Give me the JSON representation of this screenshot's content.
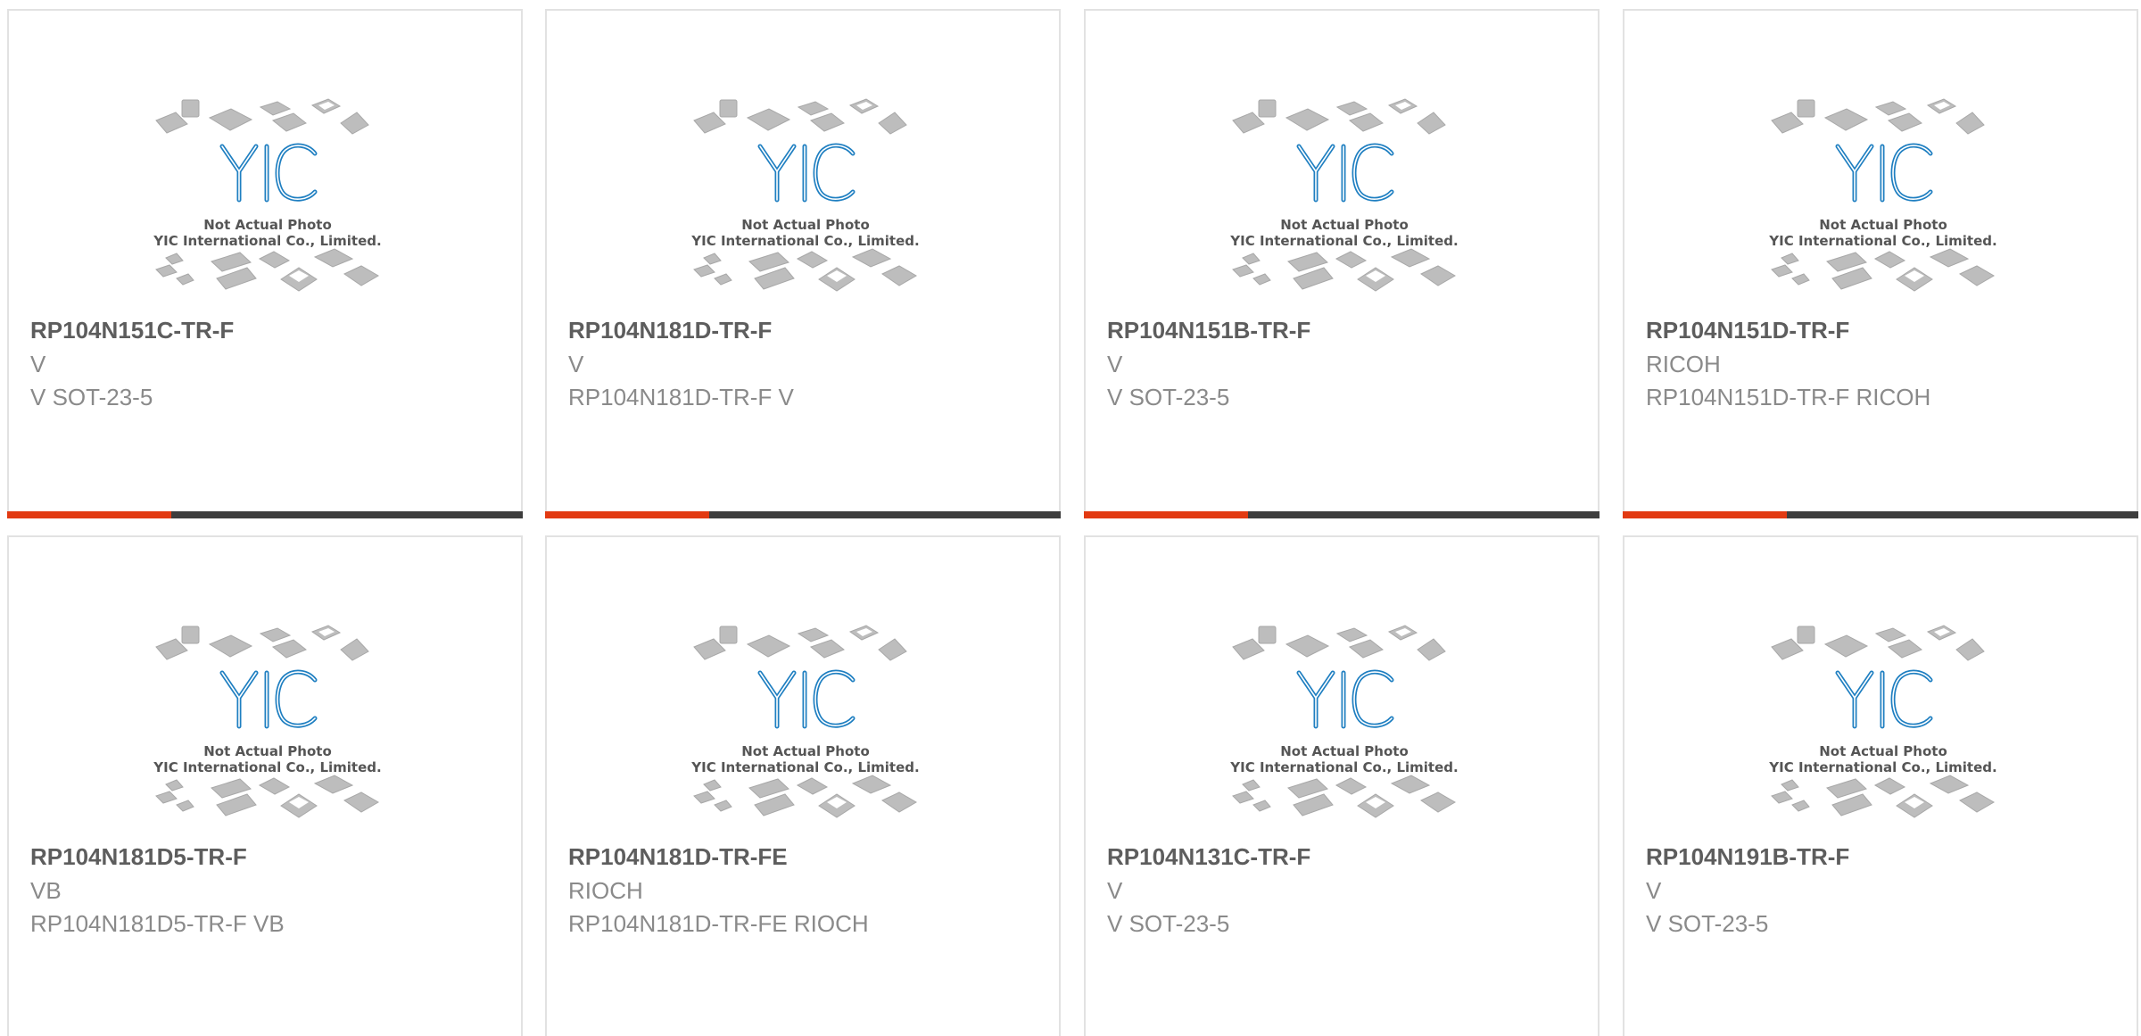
{
  "products": [
    {
      "part": "RP104N151C-TR-F",
      "brand": "V",
      "desc": "V SOT-23-5",
      "photo_caption_1": "Not Actual Photo",
      "photo_caption_2": "YIC International Co., Limited.",
      "logo_text": "YIC"
    },
    {
      "part": "RP104N181D-TR-F",
      "brand": "V",
      "desc": "RP104N181D-TR-F V",
      "photo_caption_1": "Not Actual Photo",
      "photo_caption_2": "YIC International Co., Limited.",
      "logo_text": "YIC"
    },
    {
      "part": "RP104N151B-TR-F",
      "brand": "V",
      "desc": "V SOT-23-5",
      "photo_caption_1": "Not Actual Photo",
      "photo_caption_2": "YIC International Co., Limited.",
      "logo_text": "YIC"
    },
    {
      "part": "RP104N151D-TR-F",
      "brand": "RICOH",
      "desc": "RP104N151D-TR-F RICOH",
      "photo_caption_1": "Not Actual Photo",
      "photo_caption_2": "YIC International Co., Limited.",
      "logo_text": "YIC"
    },
    {
      "part": "RP104N181D5-TR-F",
      "brand": "VB",
      "desc": "RP104N181D5-TR-F VB",
      "photo_caption_1": "Not Actual Photo",
      "photo_caption_2": "YIC International Co., Limited.",
      "logo_text": "YIC"
    },
    {
      "part": "RP104N181D-TR-FE",
      "brand": "RIOCH",
      "desc": "RP104N181D-TR-FE RIOCH",
      "photo_caption_1": "Not Actual Photo",
      "photo_caption_2": "YIC International Co., Limited.",
      "logo_text": "YIC"
    },
    {
      "part": "RP104N131C-TR-F",
      "brand": "V",
      "desc": "V SOT-23-5",
      "photo_caption_1": "Not Actual Photo",
      "photo_caption_2": "YIC International Co., Limited.",
      "logo_text": "YIC"
    },
    {
      "part": "RP104N191B-TR-F",
      "brand": "V",
      "desc": "V SOT-23-5",
      "photo_caption_1": "Not Actual Photo",
      "photo_caption_2": "YIC International Co., Limited.",
      "logo_text": "YIC"
    }
  ],
  "colors": {
    "accent": "#e23a12",
    "bar": "#3d3d3d",
    "logo_blue": "#1f7fc1",
    "chip_gray": "#b9b9b9"
  }
}
